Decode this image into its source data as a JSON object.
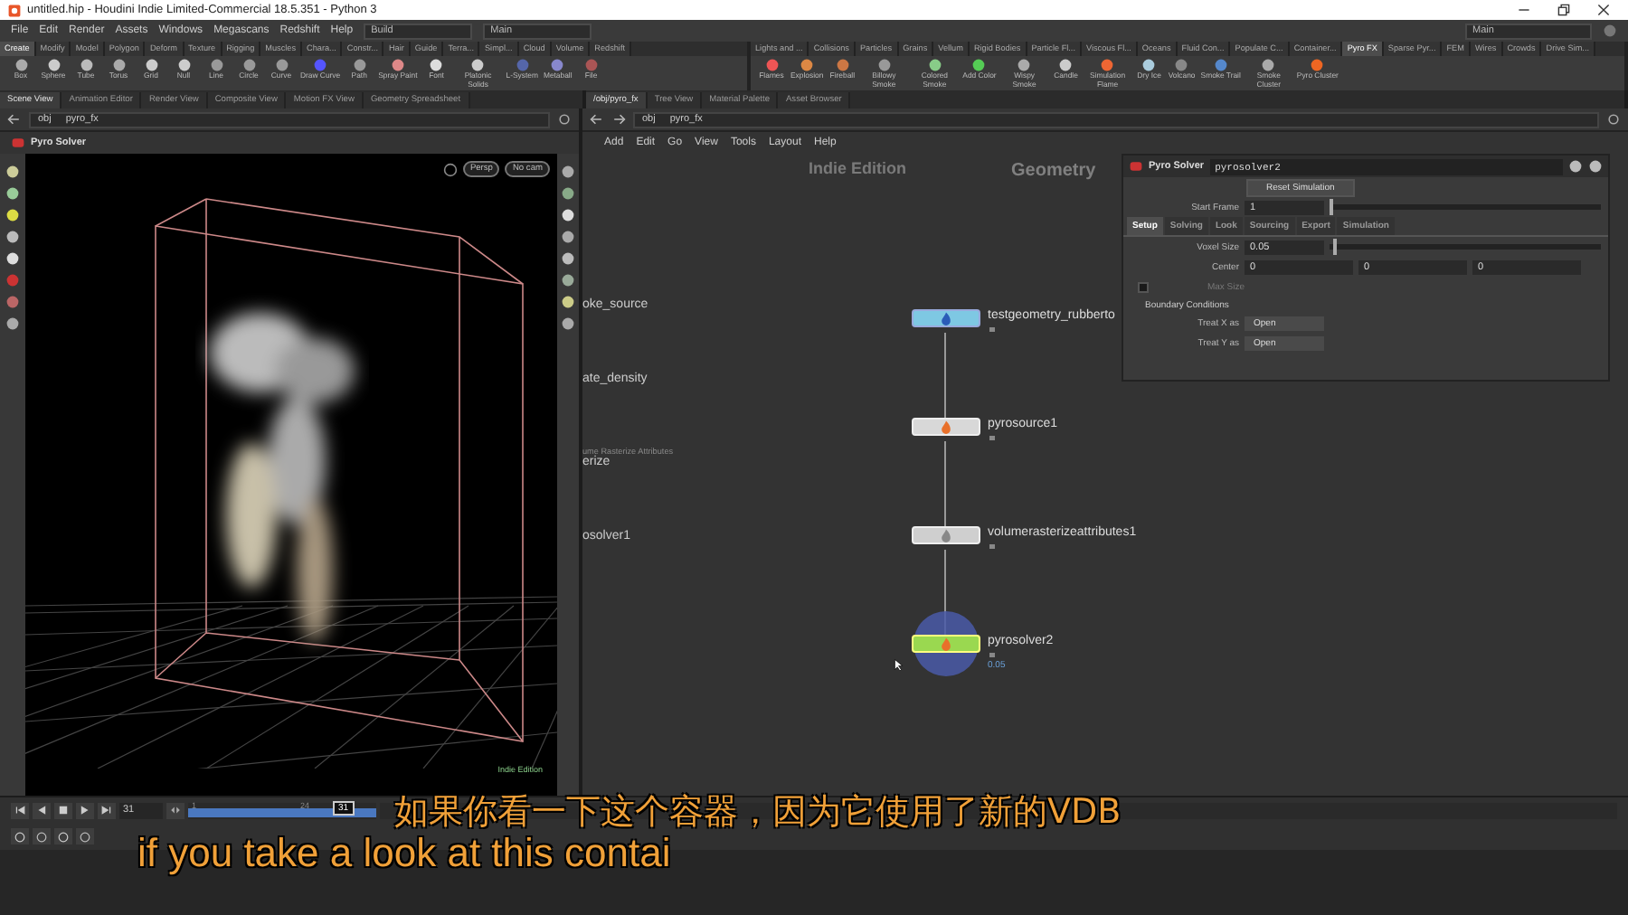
{
  "window": {
    "title": "untitled.hip - Houdini Indie Limited-Commercial 18.5.351 - Python 3"
  },
  "menu": [
    "File",
    "Edit",
    "Render",
    "Assets",
    "Windows",
    "Megascans",
    "Redshift",
    "Help"
  ],
  "desks": [
    "Build",
    "Main"
  ],
  "desk_right": "Main",
  "shelf_left": {
    "tabs": [
      {
        "label": "Create",
        "selected": true
      },
      {
        "label": "Modify",
        "selected": false
      },
      {
        "label": "Model",
        "selected": false
      },
      {
        "label": "Polygon",
        "selected": false
      },
      {
        "label": "Deform",
        "selected": false
      },
      {
        "label": "Texture",
        "selected": false
      },
      {
        "label": "Rigging",
        "selected": false
      },
      {
        "label": "Muscles",
        "selected": false
      },
      {
        "label": "Chara...",
        "selected": false
      },
      {
        "label": "Constr...",
        "selected": false
      },
      {
        "label": "Hair",
        "selected": false
      },
      {
        "label": "Guide",
        "selected": false
      },
      {
        "label": "Terra...",
        "selected": false
      },
      {
        "label": "Simpl...",
        "selected": false
      },
      {
        "label": "Cloud",
        "selected": false
      },
      {
        "label": "Volume",
        "selected": false
      },
      {
        "label": "Redshift",
        "selected": false
      }
    ],
    "tools": [
      "Box",
      "Sphere",
      "Tube",
      "Torus",
      "Grid",
      "Null",
      "Line",
      "Circle",
      "Curve",
      "Draw Curve",
      "Path",
      "Spray Paint",
      "Font",
      "Platonic Solids",
      "L-System",
      "Metaball",
      "File"
    ]
  },
  "shelf_right": {
    "tabs": [
      {
        "label": "Lights and ...",
        "selected": false
      },
      {
        "label": "Collisions",
        "selected": false
      },
      {
        "label": "Particles",
        "selected": false
      },
      {
        "label": "Grains",
        "selected": false
      },
      {
        "label": "Vellum",
        "selected": false
      },
      {
        "label": "Rigid Bodies",
        "selected": false
      },
      {
        "label": "Particle Fl...",
        "selected": false
      },
      {
        "label": "Viscous Fl...",
        "selected": false
      },
      {
        "label": "Oceans",
        "selected": false
      },
      {
        "label": "Fluid Con...",
        "selected": false
      },
      {
        "label": "Populate C...",
        "selected": false
      },
      {
        "label": "Container...",
        "selected": false
      },
      {
        "label": "Pyro FX",
        "selected": true
      },
      {
        "label": "Sparse Pyr...",
        "selected": false
      },
      {
        "label": "FEM",
        "selected": false
      },
      {
        "label": "Wires",
        "selected": false
      },
      {
        "label": "Crowds",
        "selected": false
      },
      {
        "label": "Drive Sim...",
        "selected": false
      }
    ],
    "tools": [
      "Flames",
      "Explosion",
      "Fireball",
      "Billowy Smoke",
      "Colored Smoke",
      "Add Color",
      "Wispy Smoke",
      "Candle",
      "Simulation Flame",
      "Dry Ice",
      "Volcano",
      "Smoke Trail",
      "Smoke Cluster",
      "Pyro Cluster"
    ]
  },
  "scene_pane": {
    "tabs": [
      {
        "label": "Scene View",
        "selected": true
      },
      {
        "label": "Animation Editor",
        "selected": false
      },
      {
        "label": "Render View",
        "selected": false
      },
      {
        "label": "Composite View",
        "selected": false
      },
      {
        "label": "Motion FX View",
        "selected": false
      },
      {
        "label": "Geometry Spreadsheet",
        "selected": false
      }
    ],
    "path": [
      "obj",
      "pyro_fx"
    ],
    "viewport": {
      "title": "Pyro Solver",
      "view": "Persp",
      "camera": "No cam",
      "edition": "Indie Edition"
    }
  },
  "network_pane": {
    "tabs": [
      {
        "label": "/obj/pyro_fx",
        "selected": true
      },
      {
        "label": "Tree View",
        "selected": false
      },
      {
        "label": "Material Palette",
        "selected": false
      },
      {
        "label": "Asset Browser",
        "selected": false
      }
    ],
    "path": [
      "obj",
      "pyro_fx"
    ],
    "menu": [
      "Add",
      "Edit",
      "Go",
      "View",
      "Tools",
      "Layout",
      "Help"
    ],
    "edition": "Indie Edition",
    "context": "Geometry",
    "side_labels": [
      {
        "name": "oke_source"
      },
      {
        "name": "ate_density"
      },
      {
        "type": "ume Rasterize Attributes",
        "name": "erize"
      },
      {
        "name": "osolver1"
      }
    ],
    "nodes": [
      {
        "name": "testgeometry_rubberto",
        "kind": "geometry",
        "selected": false
      },
      {
        "name": "pyrosource1",
        "kind": "source",
        "selected": false
      },
      {
        "name": "volumerasterizeattributes1",
        "kind": "rasterize",
        "selected": false
      },
      {
        "name": "pyrosolver2",
        "kind": "solver",
        "selected": true,
        "info": "0.05"
      }
    ]
  },
  "parameters": {
    "type": "Pyro Solver",
    "name": "pyrosolver2",
    "reset": "Reset Simulation",
    "start_frame": {
      "label": "Start Frame",
      "value": "1",
      "level": 0
    },
    "tabs": [
      {
        "label": "Setup",
        "selected": true
      },
      {
        "label": "Solving",
        "selected": false
      },
      {
        "label": "Look",
        "selected": false
      },
      {
        "label": "Sourcing",
        "selected": false
      },
      {
        "label": "Export",
        "selected": false
      },
      {
        "label": "Simulation",
        "selected": false
      }
    ],
    "voxel_size": {
      "label": "Voxel Size",
      "value": "0.05",
      "level": 0.01
    },
    "center": {
      "label": "Center",
      "values": [
        "0",
        "0",
        "0"
      ]
    },
    "max_size": {
      "label": "Max Size",
      "checked": false,
      "disabled": true
    },
    "section": "Boundary Conditions",
    "boundaries": [
      {
        "label": "Treat X as",
        "value": "Open"
      },
      {
        "label": "Treat Y as",
        "value": "Open"
      }
    ]
  },
  "timeline": {
    "frame": "31",
    "marker": "31",
    "ticks": [
      "1",
      "24"
    ]
  },
  "subtitles": {
    "zh": "如果你看一下这个容器，因为它使用了新的VDB",
    "en": "if you take a look at this contai"
  }
}
